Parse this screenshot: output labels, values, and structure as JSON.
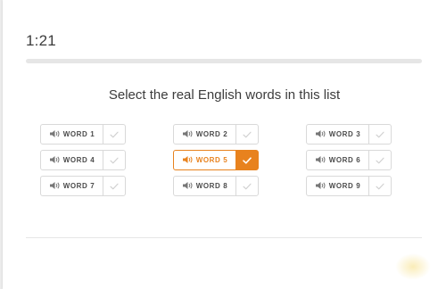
{
  "timer": "1:21",
  "prompt": "Select the real English words in this list",
  "colors": {
    "accent": "#e8821e",
    "border": "#d9d9d9",
    "text": "#4b4b4b"
  },
  "words": [
    {
      "label": "WORD 1",
      "selected": false
    },
    {
      "label": "WORD 2",
      "selected": false
    },
    {
      "label": "WORD 3",
      "selected": false
    },
    {
      "label": "WORD 4",
      "selected": false
    },
    {
      "label": "WORD 5",
      "selected": true
    },
    {
      "label": "WORD 6",
      "selected": false
    },
    {
      "label": "WORD 7",
      "selected": false
    },
    {
      "label": "WORD 8",
      "selected": false
    },
    {
      "label": "WORD 9",
      "selected": false
    }
  ]
}
